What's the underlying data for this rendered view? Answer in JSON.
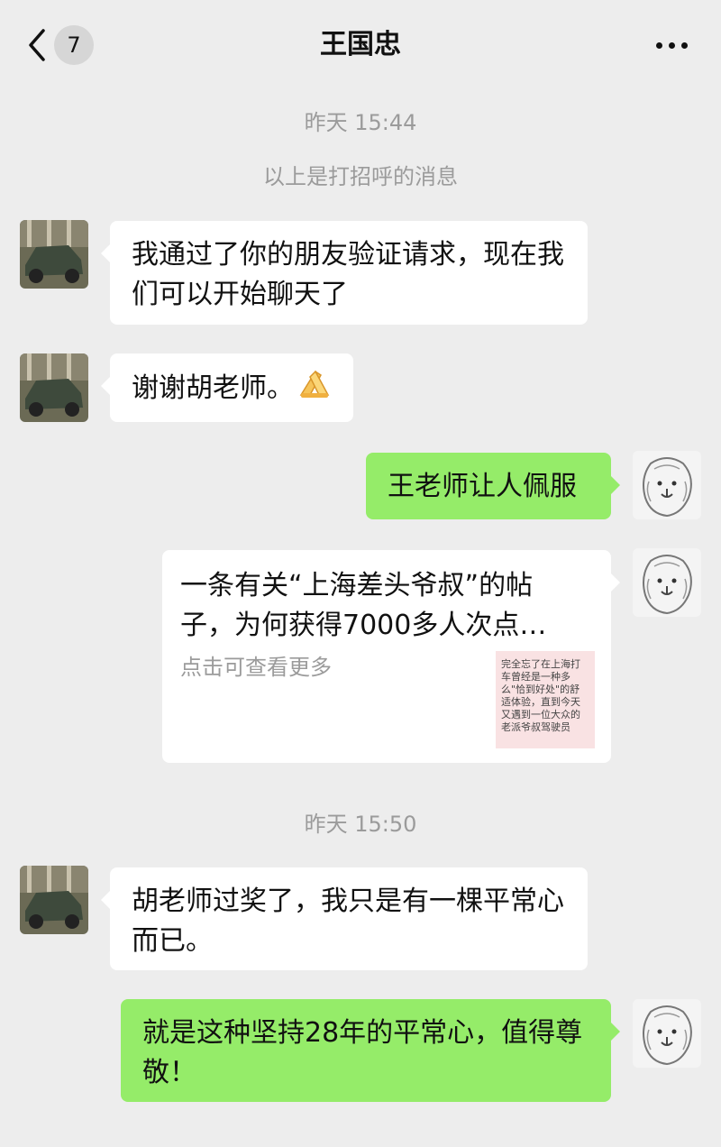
{
  "header": {
    "unread_count": "7",
    "title": "王国忠"
  },
  "messages": {
    "ts1": "昨天 15:44",
    "notice": "以上是打招呼的消息",
    "m1": "我通过了你的朋友验证请求，现在我们可以开始聊天了",
    "m2": "谢谢胡老师。",
    "m3": "王老师让人佩服",
    "card": {
      "title": "一条有关“上海差头爷叔”的帖子，为何获得7000多人次点…",
      "desc": "点击可查看更多",
      "thumb_text": "完全忘了在上海打车曾经是一种多么\"恰到好处\"的舒适体验，直到今天又遇到一位大众的老派爷叔驾驶员"
    },
    "ts2": "昨天 15:50",
    "m4": "胡老师过奖了，我只是有一棵平常心而已。",
    "m5": "就是这种坚持28年的平常心，值得尊敬！"
  },
  "colors": {
    "background": "#ededed",
    "self_bubble": "#95ec69",
    "other_bubble": "#ffffff"
  }
}
